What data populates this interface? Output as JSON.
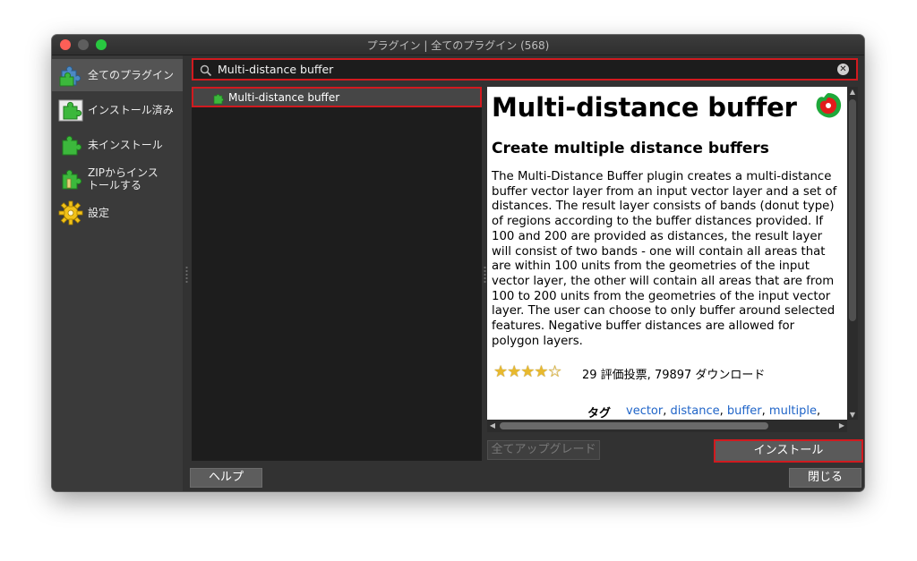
{
  "window": {
    "title": "プラグイン | 全てのプラグイン (568)"
  },
  "sidebar": {
    "items": [
      {
        "label": "全てのプラグイン",
        "icon": "puzzle-all-icon",
        "selected": true
      },
      {
        "label": "インストール済み",
        "icon": "puzzle-installed-icon",
        "selected": false
      },
      {
        "label": "未インストール",
        "icon": "puzzle-not-installed-icon",
        "selected": false
      },
      {
        "label_line1": "ZIPからインス",
        "label_line2": "トールする",
        "icon": "puzzle-zip-icon",
        "selected": false
      },
      {
        "label": "設定",
        "icon": "gear-icon",
        "selected": false
      }
    ]
  },
  "search": {
    "value": "Multi-distance buffer",
    "icon": "search-icon",
    "clear_icon": "clear-icon"
  },
  "plugin_list": {
    "items": [
      {
        "name": "Multi-distance buffer"
      }
    ]
  },
  "details": {
    "title": "Multi-distance buffer",
    "subtitle": "Create multiple distance buffers",
    "description": "The Multi-Distance Buffer plugin creates a multi-distance buffer vector layer from an input vector layer and a set of distances. The result layer consists of bands (donut type) of regions according to the buffer distances provided. If 100 and 200 are provided as distances, the result layer will consist of two bands - one will contain all areas that are within 100 units from the geometries of the input vector layer, the other will contain all areas that are from 100 to 200 units from the geometries of the input vector layer. The user can choose to only buffer around selected features. Negative buffer distances are allowed for polygon layers.",
    "rating": {
      "stars": 4.5,
      "max": 5
    },
    "votes": "29 評価投票, 79897 ダウンロード",
    "tags_label": "タグ",
    "tags": [
      "vector",
      "distance",
      "buffer",
      "multiple"
    ]
  },
  "buttons": {
    "upgrade_all": "全てアップグレード",
    "install": "インストール",
    "help": "ヘルプ",
    "close": "閉じる"
  },
  "colors": {
    "highlight": "#d11a1f",
    "link": "#1f64c8",
    "puzzle_green": "#3cb83c"
  }
}
